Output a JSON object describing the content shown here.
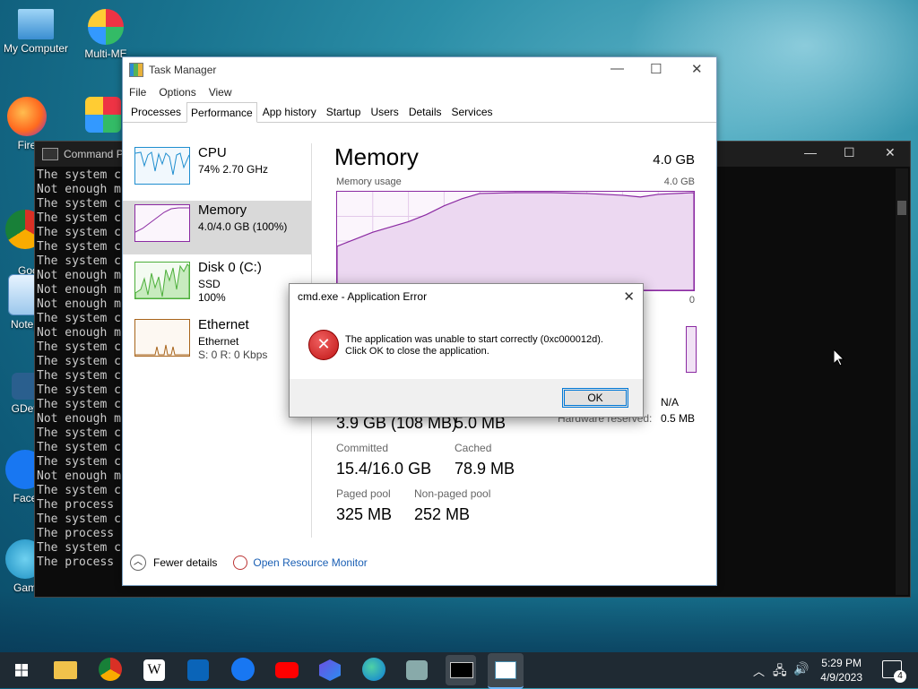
{
  "desktop": {
    "icons": [
      {
        "label": "My Computer"
      },
      {
        "label": "Multi-ME"
      },
      {
        "label": "Fire"
      },
      {
        "label": "Goo\nChr"
      },
      {
        "label": "Notep"
      },
      {
        "label": "GDev"
      },
      {
        "label": "Face"
      },
      {
        "label": "Gam"
      }
    ]
  },
  "cmd": {
    "title": "Command P",
    "lines": [
      "The system c",
      "Not enough m",
      "The system c",
      "The system c",
      "The system c",
      "The system c",
      "The system c",
      "Not enough m",
      "Not enough m",
      "Not enough m",
      "The system c",
      "Not enough m",
      "The system c",
      "The system c",
      "The system c",
      "The system c",
      "The system c",
      "Not enough m",
      "The system c",
      "The system c",
      "The system c",
      "Not enough m",
      "The system c",
      "The process",
      "The system c",
      "The process",
      "The system c",
      "The process"
    ]
  },
  "taskmgr": {
    "title": "Task Manager",
    "menu": [
      "File",
      "Options",
      "View"
    ],
    "tabs": [
      "Processes",
      "Performance",
      "App history",
      "Startup",
      "Users",
      "Details",
      "Services"
    ],
    "sidebar": [
      {
        "name": "CPU",
        "line2": "74% 2.70 GHz",
        "line3": ""
      },
      {
        "name": "Memory",
        "line2": "4.0/4.0 GB (100%)",
        "line3": ""
      },
      {
        "name": "Disk 0 (C:)",
        "line2": "SSD",
        "line3": "100%"
      },
      {
        "name": "Ethernet",
        "line2": "Ethernet",
        "line3": "S: 0 R: 0 Kbps"
      }
    ],
    "memory": {
      "heading": "Memory",
      "total": "4.0 GB",
      "usage_label": "Memory usage",
      "usage_max": "4.0 GB",
      "zero": "0",
      "in_use": "3.9 GB (108 MB)",
      "available": "5.0 MB",
      "hw_reserved_label": "Hardware reserved:",
      "hw_reserved": "0.5 MB",
      "na": "N/A",
      "committed_label": "Committed",
      "committed": "15.4/16.0 GB",
      "cached_label": "Cached",
      "cached": "78.9 MB",
      "paged_label": "Paged pool",
      "paged": "325 MB",
      "nonpaged_label": "Non-paged pool",
      "nonpaged": "252 MB"
    },
    "footer": {
      "fewer": "Fewer details",
      "monitor": "Open Resource Monitor"
    }
  },
  "dialog": {
    "title": "cmd.exe - Application Error",
    "line1": "The application was unable to start correctly (0xc000012d).",
    "line2": "Click OK to close the application.",
    "ok": "OK"
  },
  "taskbar": {
    "time": "5:29 PM",
    "date": "4/9/2023",
    "notifications": "4"
  },
  "colors": {
    "memory": "#8b2aa2",
    "cpu": "#1f8ecf",
    "disk": "#4caf3a",
    "ethernet": "#a8641b"
  }
}
